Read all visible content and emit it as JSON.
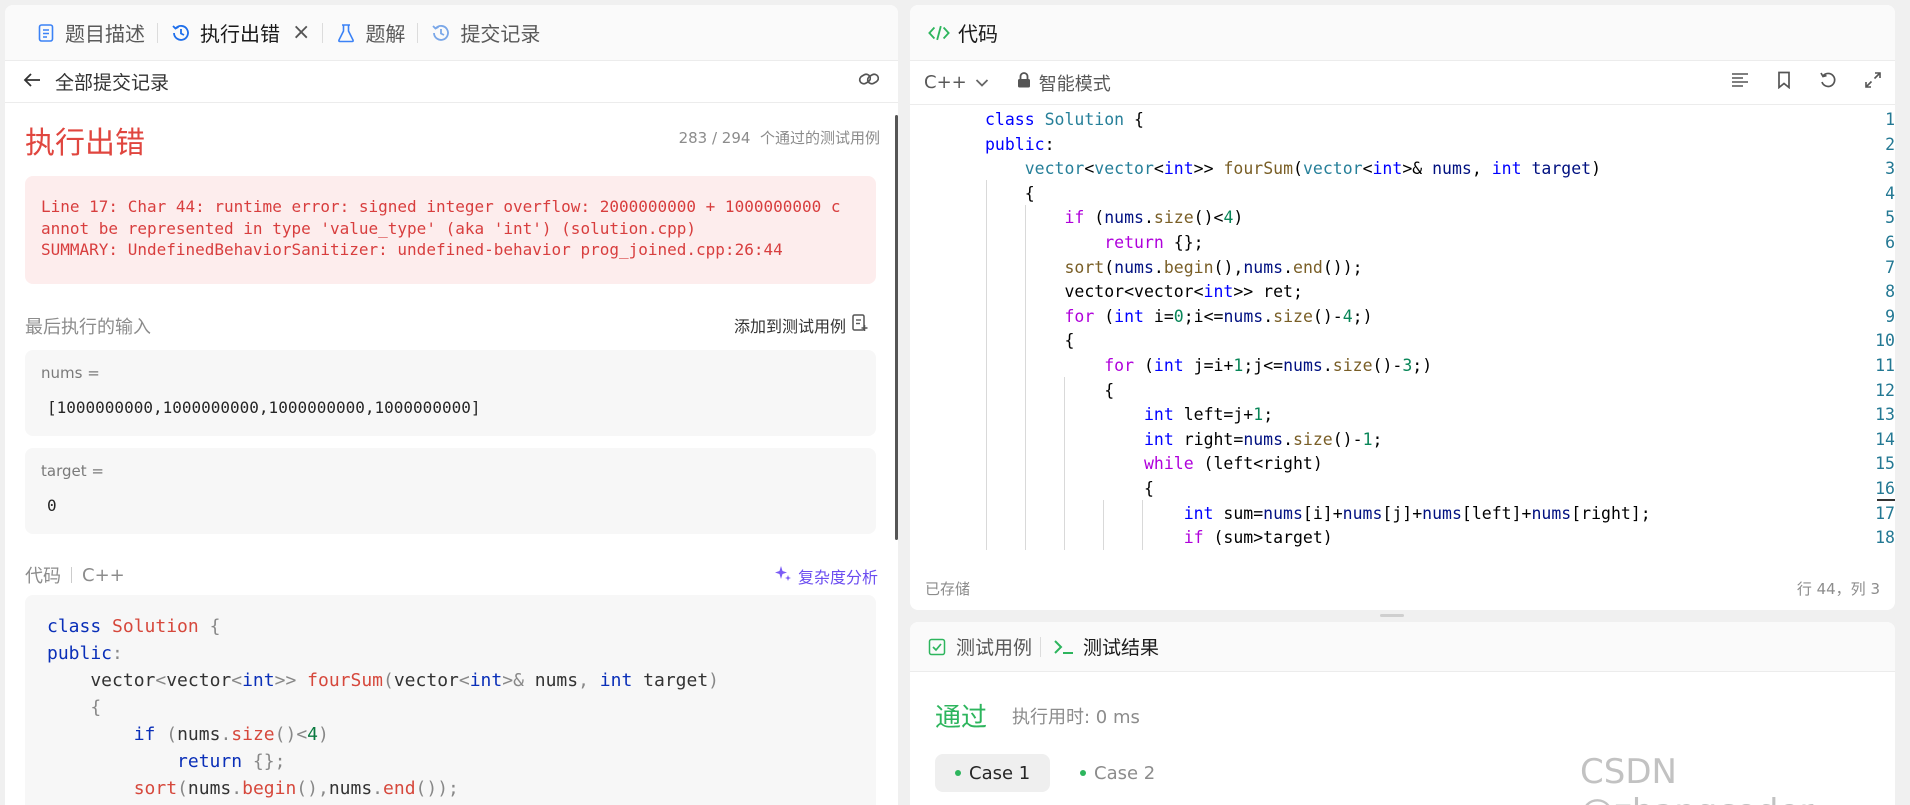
{
  "left_tabs": {
    "description": "题目描述",
    "error": "执行出错",
    "solution": "题解",
    "submissions": "提交记录"
  },
  "left_sub": {
    "back_label": "全部提交记录"
  },
  "result": {
    "title": "执行出错",
    "pass_count": "283 / 294",
    "pass_suffix": "个通过的测试用例",
    "error_line1": "Line 17: Char 44: runtime error: signed integer overflow: 2000000000 + 1000000000 c",
    "error_line2": "annot be represented in type 'value_type' (aka 'int') (solution.cpp)",
    "error_line3": "SUMMARY: UndefinedBehaviorSanitizer: undefined-behavior prog_joined.cpp:26:44"
  },
  "last_input": {
    "label": "最后执行的输入",
    "add_case": "添加到测试用例",
    "nums_label": "nums =",
    "nums_value": "[1000000000,1000000000,1000000000,1000000000]",
    "target_label": "target =",
    "target_value": "0"
  },
  "code_section": {
    "label": "代码",
    "lang": "C++",
    "complexity": "复杂度分析"
  },
  "editor": {
    "title": "代码",
    "lang": "C++",
    "mode": "智能模式",
    "saved": "已存储",
    "cursor": "行 44，列 3",
    "line_numbers": [
      "1",
      "2",
      "3",
      "4",
      "5",
      "6",
      "7",
      "8",
      "9",
      "10",
      "11",
      "12",
      "13",
      "14",
      "15",
      "16",
      "17",
      "18"
    ]
  },
  "bottom": {
    "tab_cases": "测试用例",
    "tab_results": "测试结果",
    "status": "通过",
    "runtime": "执行用时: 0 ms",
    "case1": "Case 1",
    "case2": "Case 2"
  },
  "watermark": "CSDN @zhangcoder",
  "colors": {
    "error": "#e0463f",
    "success": "#2db55d",
    "accent": "#6a4cf0"
  }
}
